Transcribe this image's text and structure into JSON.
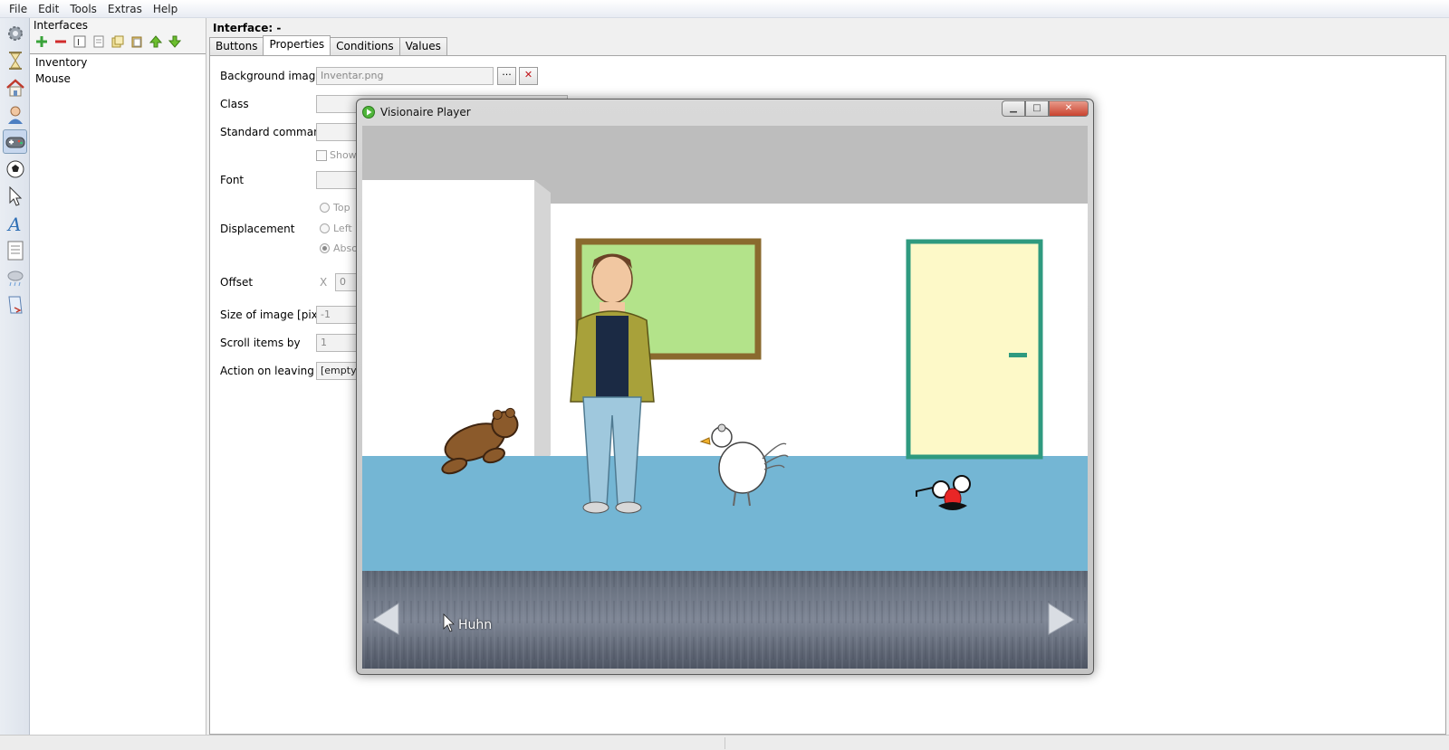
{
  "menu": [
    "File",
    "Edit",
    "Tools",
    "Extras",
    "Help"
  ],
  "sidebar_icons": [
    "gear-icon",
    "hourglass-icon",
    "home-icon",
    "character-icon",
    "gamepad-icon",
    "ball-icon",
    "cursor-icon",
    "font-icon",
    "text-icon",
    "weather-icon",
    "script-icon"
  ],
  "interfaces": {
    "header": "Interfaces",
    "items": [
      "Inventory",
      "Mouse"
    ]
  },
  "interface": {
    "title": "Interface: -",
    "tabs": [
      "Buttons",
      "Properties",
      "Conditions",
      "Values"
    ],
    "active_tab": "Properties"
  },
  "properties": {
    "background_image_label": "Background image",
    "background_image_value": "Inventar.png",
    "browse_label": "···",
    "clear_label": "✕",
    "class_label": "Class",
    "standard_command_label": "Standard command",
    "show_label": "Show",
    "font_label": "Font",
    "displacement_label": "Displacement",
    "displacement_top": "Top",
    "displacement_left": "Left",
    "displacement_absolute": "Abso",
    "offset_label": "Offset",
    "offset_x_label": "X",
    "offset_x_value": "0",
    "size_label": "Size of image [pixel]",
    "size_value": "-1",
    "scroll_label": "Scroll items by",
    "scroll_value": "1",
    "action_label": "Action on leaving",
    "action_value": "[empty]"
  },
  "player": {
    "title": "Visionaire Player",
    "hover_text": "Huhn",
    "colors": {
      "ceiling": "#bdbdbd",
      "wall": "#ffffff",
      "floor": "#74b6d4",
      "board": "#b3e38a",
      "board_frame": "#8a6a2e",
      "door": "#fdf9c8",
      "door_frame": "#2f9a7f"
    }
  }
}
